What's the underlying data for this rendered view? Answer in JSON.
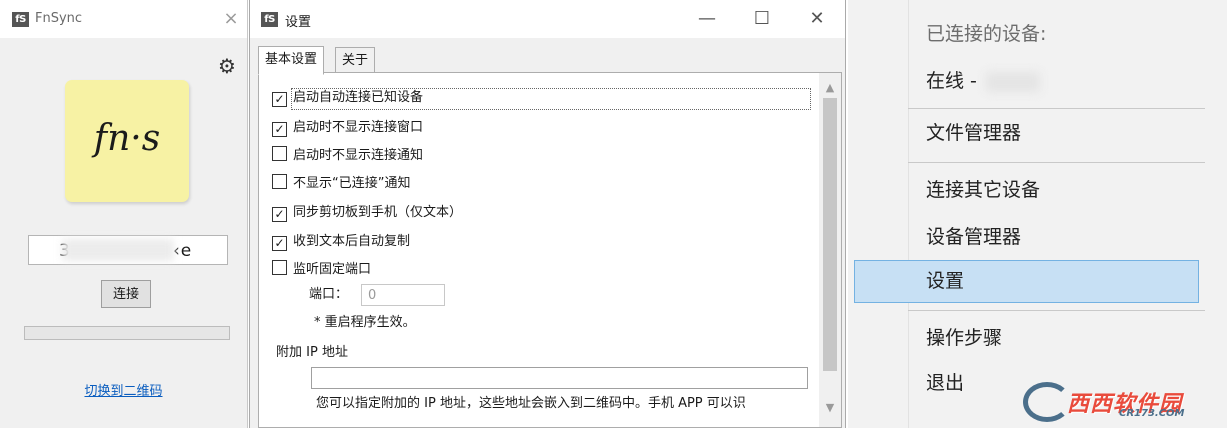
{
  "fnsync_window": {
    "app_icon": "fS",
    "title": "FnSync",
    "close_glyph": "×",
    "settings_icon": "gear-icon",
    "logo_text": "fn·s",
    "code_value": "3",
    "code_value_tail": "‹e",
    "connect_label": "连接",
    "progress": 0,
    "qr_link": "切换到二维码"
  },
  "settings_window": {
    "app_icon": "fS",
    "title": "设置",
    "minimize_glyph": "—",
    "maximize_glyph": "☐",
    "close_glyph": "✕",
    "tabs": [
      {
        "label": "基本设置",
        "active": true
      },
      {
        "label": "关于",
        "active": false
      }
    ],
    "options": [
      {
        "label": "启动自动连接已知设备",
        "checked": true
      },
      {
        "label": "启动时不显示连接窗口",
        "checked": true
      },
      {
        "label": "启动时不显示连接通知",
        "checked": false
      },
      {
        "label": "不显示“已连接”通知",
        "checked": false
      },
      {
        "label": "同步剪切板到手机（仅文本）",
        "checked": true
      },
      {
        "label": "收到文本后自动复制",
        "checked": true
      },
      {
        "label": "监听固定端口",
        "checked": false
      }
    ],
    "port_label": "端口：",
    "port_value": "0",
    "restart_note": "* 重启程序生效。",
    "extra_ip_label": "附加 IP 地址",
    "extra_ip_value": "",
    "extra_ip_desc": "您可以指定附加的 IP 地址，这些地址会嵌入到二维码中。手机 APP 可以识",
    "scroll_up": "▲",
    "scroll_down": "▼"
  },
  "context_menu": {
    "header": "已连接的设备:",
    "online_label": "在线 -",
    "items": [
      {
        "label": "文件管理器"
      },
      {
        "label": "连接其它设备"
      },
      {
        "label": "设备管理器"
      },
      {
        "label": "设置",
        "highlighted": true
      },
      {
        "label": "操作步骤"
      },
      {
        "label": "退出"
      }
    ]
  },
  "watermark": {
    "brand_cn": "西西软件园",
    "site": "CR173.COM"
  }
}
